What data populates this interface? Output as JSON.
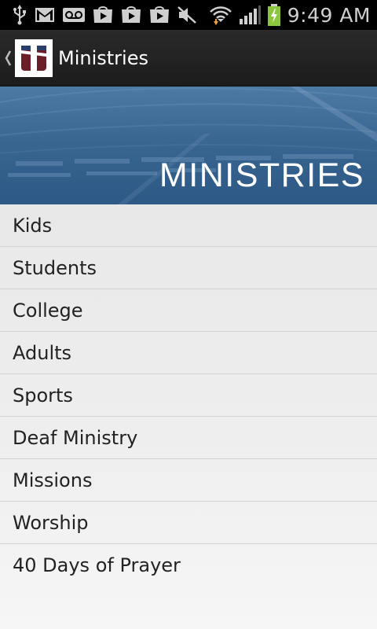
{
  "status_bar": {
    "time": "9:49 AM",
    "icons": [
      "usb-icon",
      "gmail-icon",
      "voicemail-icon",
      "play-store-icon",
      "play-store-icon",
      "play-store-icon",
      "mute-icon",
      "wifi-icon",
      "signal-icon",
      "battery-charging-icon"
    ]
  },
  "action_bar": {
    "title": "Ministries"
  },
  "banner": {
    "title": "MINISTRIES"
  },
  "menu": {
    "items": [
      {
        "label": "Kids"
      },
      {
        "label": "Students"
      },
      {
        "label": "College"
      },
      {
        "label": "Adults"
      },
      {
        "label": "Sports"
      },
      {
        "label": "Deaf Ministry"
      },
      {
        "label": "Missions"
      },
      {
        "label": "Worship"
      },
      {
        "label": "40 Days of Prayer"
      }
    ]
  },
  "colors": {
    "status_bar_bg": "#000000",
    "action_bar_bg": "#222222",
    "banner_blue": "#34628f",
    "list_bg": "#ececec",
    "logo_maroon": "#6b1e2a",
    "logo_navy": "#2a3f68",
    "battery_green": "#8cc63f"
  }
}
